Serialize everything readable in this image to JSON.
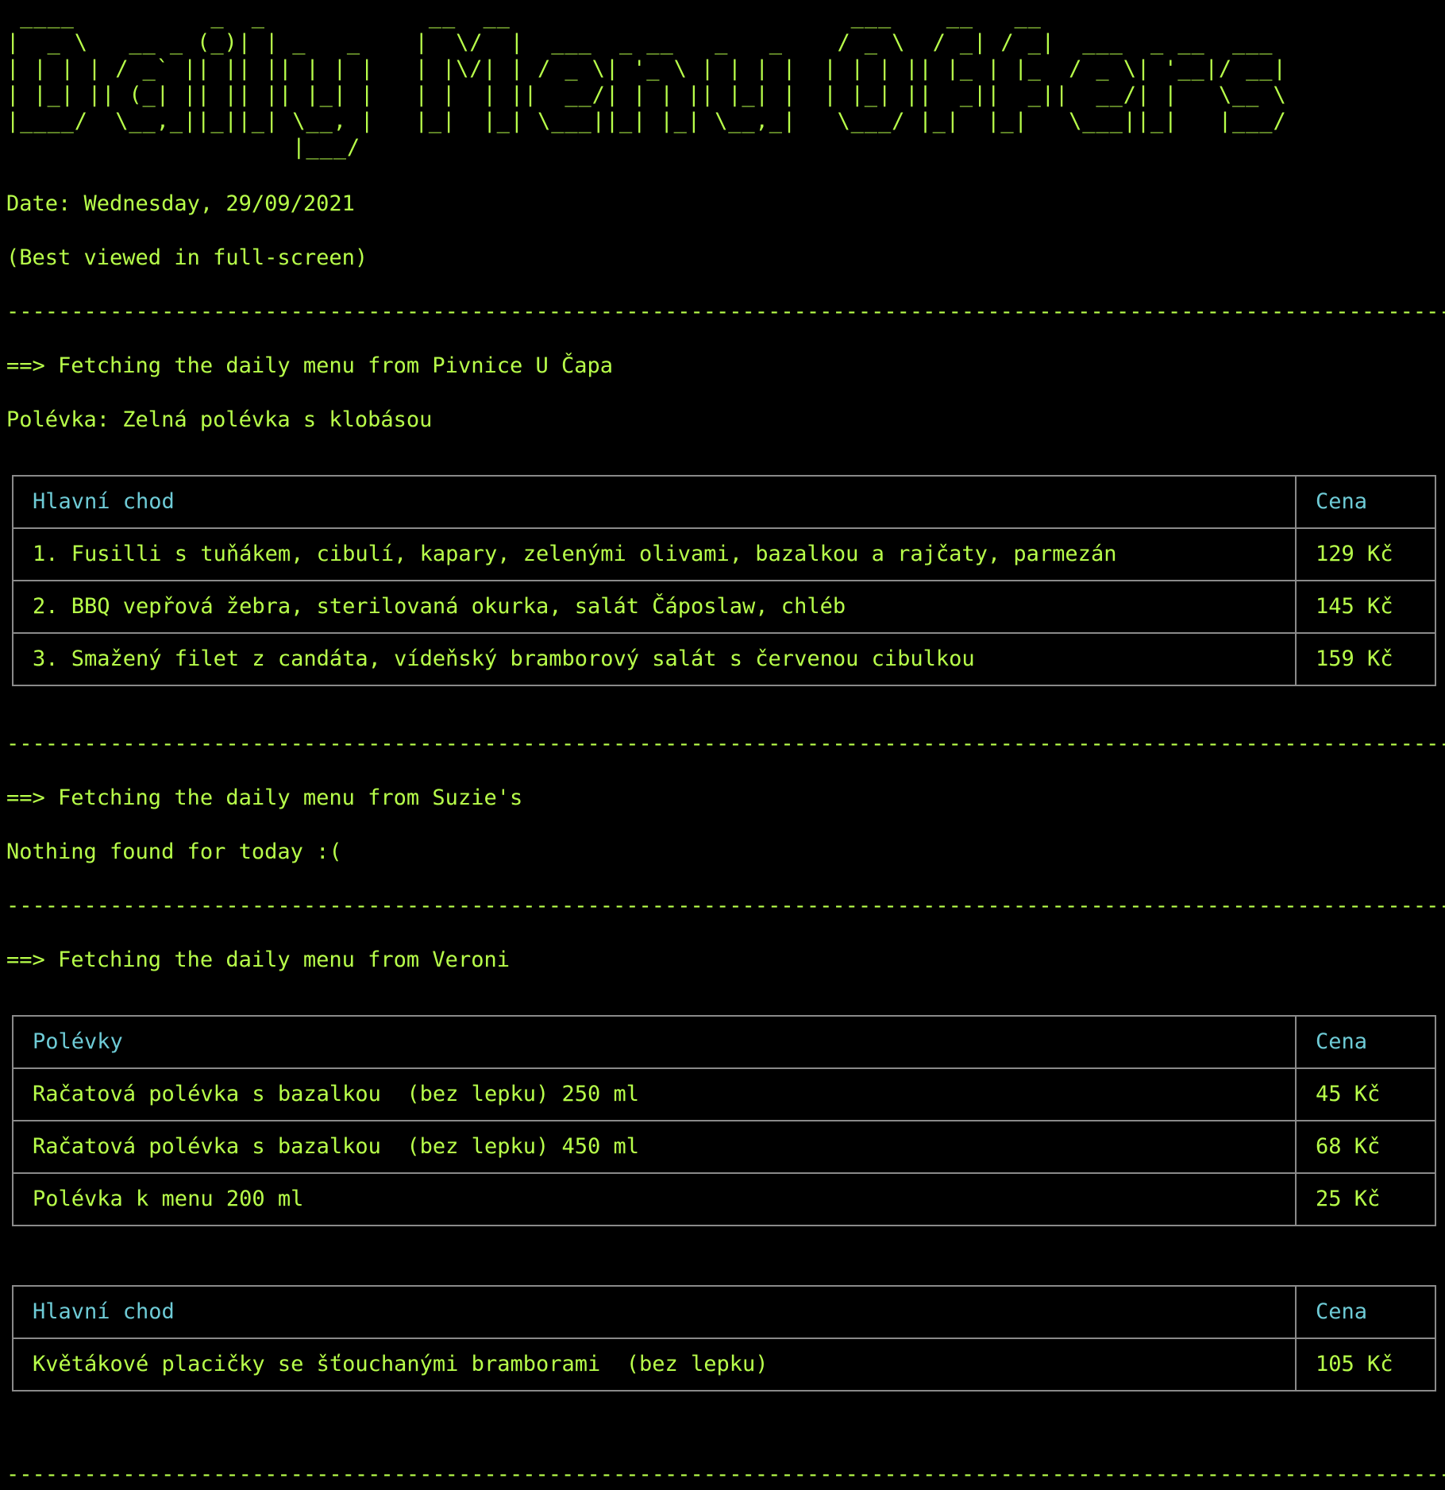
{
  "banner_lines": [
    " ____          _  _            __  __                         ___    __   __                  ",
    "|  _ \\   __ _ (_)| | _   _    |  \\/  |  ___  _ __   _   _    / _ \\  / _| / _|  ___  _ __  ___ ",
    "| | | | / _` || || || | | |   | |\\/| | / _ \\| '_ \\ | | | |  | | | || |_ | |_  / _ \\| '__|/ __|",
    "| |_| || (_| || || || |_| |   | |  | ||  __/| | | || |_| |  | |_| ||  _||  _||  __/| |   \\__ \\",
    "|____/  \\__,_||_||_| \\__, |   |_|  |_| \\___||_| |_| \\__,_|   \\___/ |_|  |_|   \\___||_|   |___/",
    "                     |___/                                                                     "
  ],
  "date_line": "Date: Wednesday, 29/09/2021",
  "hint_line": "(Best viewed in full-screen)",
  "separator": "---------------------------------------------------------------------------------------------------------------------------------------------------",
  "sections": {
    "capa": {
      "fetch_line": "==> Fetching the daily menu from Pivnice U Čapa",
      "soup_line": "Polévka: Zelná polévka s klobásou",
      "table": {
        "headers": [
          "Hlavní chod",
          "Cena"
        ],
        "rows": [
          [
            "1. Fusilli s tuňákem, cibulí, kapary, zelenými olivami, bazalkou a rajčaty, parmezán",
            "129 Kč"
          ],
          [
            "2. BBQ vepřová žebra, sterilovaná okurka, salát Čáposlaw, chléb",
            "145 Kč"
          ],
          [
            "3. Smažený filet z candáta, vídeňský bramborový salát s červenou cibulkou",
            "159 Kč"
          ]
        ]
      }
    },
    "suzies": {
      "fetch_line": "==> Fetching the daily menu from Suzie's",
      "empty_line": "Nothing found for today :("
    },
    "veroni": {
      "fetch_line": "==> Fetching the daily menu from Veroni",
      "soup_table": {
        "headers": [
          "Polévky",
          "Cena"
        ],
        "rows": [
          [
            "Račatová polévka s bazalkou  (bez lepku) 250 ml",
            "45 Kč"
          ],
          [
            "Račatová polévka s bazalkou  (bez lepku) 450 ml",
            "68 Kč"
          ],
          [
            "Polévka k menu 200 ml",
            "25 Kč"
          ]
        ]
      },
      "main_table": {
        "headers": [
          "Hlavní chod",
          "Cena"
        ],
        "rows": [
          [
            "Květákové placičky se šťouchanými bramborami  (bez lepku)",
            "105 Kč"
          ]
        ]
      }
    }
  },
  "colors": {
    "text": "#b8ff4a",
    "header_text": "#6ecbd6",
    "table_border": "#8a8a8a",
    "background": "#000000"
  }
}
